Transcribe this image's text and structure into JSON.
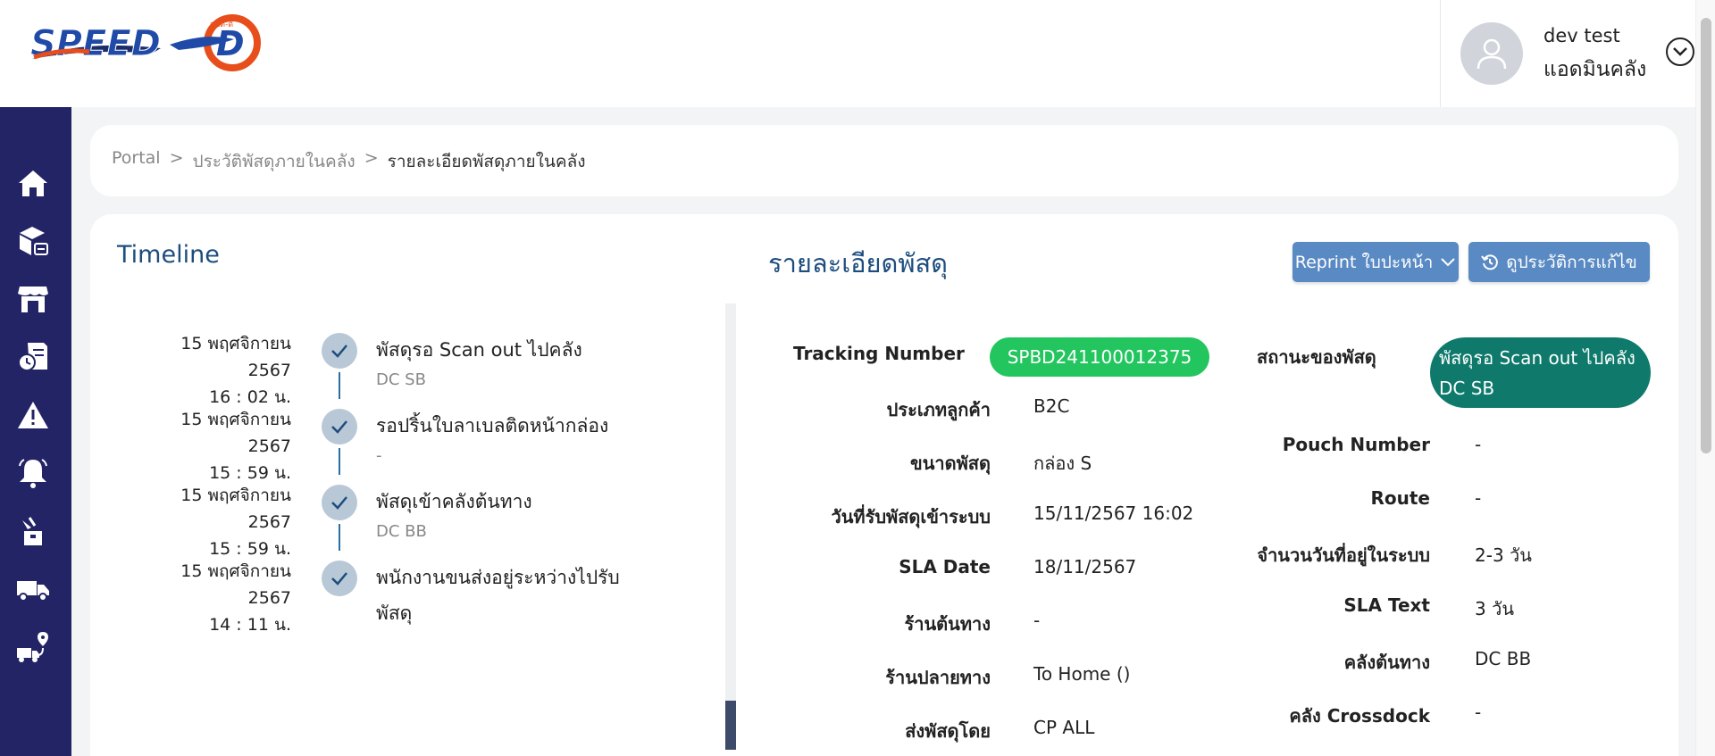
{
  "brand": {
    "logo_text": "SPEED",
    "logo_sub": "สปีด-ดี"
  },
  "user": {
    "name": "dev test",
    "role": "แอดมินคลัง"
  },
  "breadcrumb": {
    "root": "Portal",
    "sep": ">",
    "parent": "ประวัติพัสดุภายในคลัง",
    "current": "รายละเอียดพัสดุภายในคลัง"
  },
  "timeline": {
    "title": "Timeline",
    "entries": [
      {
        "date": "15 พฤศจิกายน",
        "year": "2567",
        "time": "16 : 02 น.",
        "title": "พัสดุรอ Scan out ไปคลัง",
        "sub": "DC SB"
      },
      {
        "date": "15 พฤศจิกายน",
        "year": "2567",
        "time": "15 : 59 น.",
        "title": "รอปริ้นใบลาเบลติดหน้ากล่อง",
        "sub": "-"
      },
      {
        "date": "15 พฤศจิกายน",
        "year": "2567",
        "time": "15 : 59 น.",
        "title": "พัสดุเข้าคลังต้นทาง",
        "sub": "DC BB"
      },
      {
        "date": "15 พฤศจิกายน",
        "year": "2567",
        "time": "14 : 11 น.",
        "title": "พนักงานขนส่งอยู่ระหว่างไปรับพัสดุ",
        "sub": ""
      }
    ]
  },
  "detail": {
    "title": "รายละเอียดพัสดุ",
    "reprint_label": "Reprint ใบปะหน้า",
    "history_label": "ดูประวัติการแก้ไข",
    "left": [
      {
        "label": "Tracking Number",
        "value": "SPBD241100012375"
      },
      {
        "label": "ประเภทลูกค้า",
        "value": "B2C"
      },
      {
        "label": "ขนาดพัสดุ",
        "value": "กล่อง S"
      },
      {
        "label": "วันที่รับพัสดุเข้าระบบ",
        "value": "15/11/2567 16:02"
      },
      {
        "label": "SLA Date",
        "value": "18/11/2567"
      },
      {
        "label": "ร้านต้นทาง",
        "value": "-"
      },
      {
        "label": "ร้านปลายทาง",
        "value": "To Home ()"
      },
      {
        "label": "ส่งพัสดุโดย",
        "value": "CP ALL"
      }
    ],
    "right": [
      {
        "label": "สถานะของพัสดุ",
        "value": "พัสดุรอ Scan out ไปคลัง DC SB"
      },
      {
        "label": "Pouch Number",
        "value": "-"
      },
      {
        "label": "Route",
        "value": "-"
      },
      {
        "label": "จำนวนวันที่อยู่ในระบบ",
        "value": "2-3 วัน"
      },
      {
        "label": "SLA Text",
        "value": "3 วัน"
      },
      {
        "label": "คลังต้นทาง",
        "value": "DC BB"
      },
      {
        "label": "คลัง Crossdock",
        "value": "-"
      }
    ]
  },
  "colors": {
    "sidebar": "#232465",
    "accent": "#1d4d7e",
    "button": "#5a8ac4",
    "tracking_pill": "#22c55e",
    "status_pill": "#0f7a6c"
  },
  "sidebar_icons": [
    "home-icon",
    "parcel-scan-icon",
    "store-icon",
    "document-clock-icon",
    "warning-icon",
    "bell-icon",
    "parcel-drop-icon",
    "truck-icon",
    "route-truck-icon"
  ]
}
